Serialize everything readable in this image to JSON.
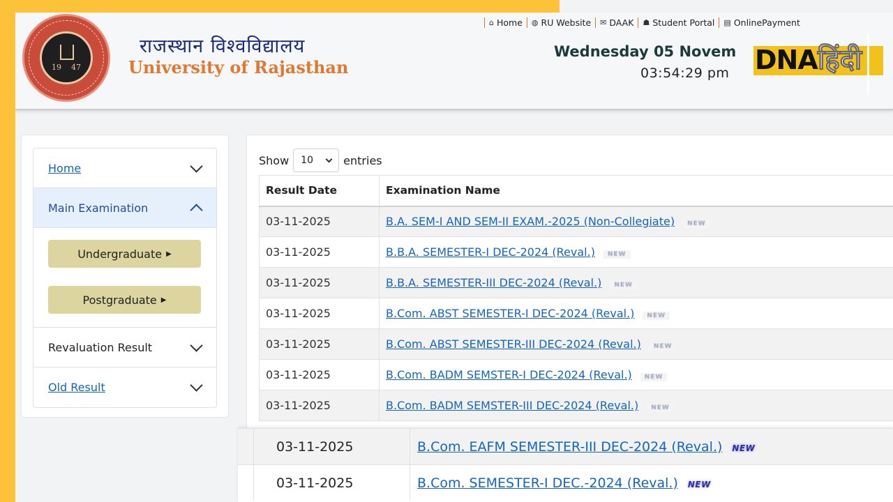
{
  "header": {
    "university_hindi": "राजस्थान विश्वविद्यालय",
    "university_english": "University of Rajasthan",
    "logo_year_left": "19",
    "logo_year_right": "47",
    "date": "Wednesday 05 Novem",
    "time": "03:54:29 pm",
    "nav": [
      {
        "icon": "home-icon",
        "label": "Home"
      },
      {
        "icon": "globe-icon",
        "label": "RU Website"
      },
      {
        "icon": "mail-icon",
        "label": "DAAK"
      },
      {
        "icon": "user-icon",
        "label": "Student Portal"
      },
      {
        "icon": "card-icon",
        "label": "OnlinePayment"
      }
    ],
    "watermark": {
      "latin": "DNA",
      "hindi": "हिंदी"
    }
  },
  "sidebar": {
    "items": [
      {
        "label": "Home",
        "state": "collapsed"
      },
      {
        "label": "Main Examination",
        "state": "expanded"
      },
      {
        "label": "Revaluation Result",
        "state": "collapsed"
      },
      {
        "label": "Old Result",
        "state": "collapsed"
      }
    ],
    "sub_buttons": [
      "Undergraduate",
      "Postgraduate"
    ]
  },
  "table_controls": {
    "show_label": "Show",
    "entries_value": "10",
    "entries_label": "entries"
  },
  "table": {
    "headers": [
      "Result Date",
      "Examination Name"
    ],
    "new_label": "NEW",
    "rows": [
      {
        "date": "03-11-2025",
        "name": "B.A. SEM-I AND SEM-II EXAM.-2025 (Non-Collegiate)"
      },
      {
        "date": "03-11-2025",
        "name": "B.B.A. SEMESTER-I DEC-2024 (Reval.)"
      },
      {
        "date": "03-11-2025",
        "name": "B.B.A. SEMESTER-III DEC-2024 (Reval.)"
      },
      {
        "date": "03-11-2025",
        "name": "B.Com. ABST SEMESTER-I DEC-2024 (Reval.)"
      },
      {
        "date": "03-11-2025",
        "name": "B.Com. ABST SEMESTER-III DEC-2024 (Reval.)"
      },
      {
        "date": "03-11-2025",
        "name": "B.Com. BADM SEMSTER-I DEC-2024 (Reval.)"
      },
      {
        "date": "03-11-2025",
        "name": "B.Com. BADM SEMSTER-III DEC-2024 (Reval.)"
      }
    ],
    "zoomed_rows": [
      {
        "date": "03-11-2025",
        "name": "B.Com. EAFM SEMESTER-III DEC-2024 (Reval.)"
      },
      {
        "date": "03-11-2025",
        "name": "B.Com. SEMESTER-I DEC.-2024 (Reval.)"
      }
    ]
  },
  "colors": {
    "frame": "#fcc33a",
    "link": "#1565c0",
    "accent_orange": "#e0782f",
    "sub_button": "#ddd5a0"
  }
}
